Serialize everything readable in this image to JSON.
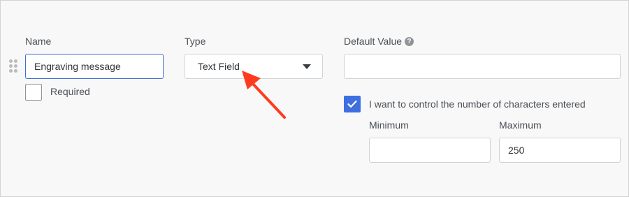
{
  "fields": {
    "name": {
      "label": "Name",
      "value": "Engraving message"
    },
    "required": {
      "label": "Required",
      "checked": false
    },
    "type": {
      "label": "Type",
      "selected": "Text Field"
    },
    "default_value": {
      "label": "Default Value",
      "value": "",
      "help_icon": "question-circle-icon"
    },
    "limit_characters": {
      "label": "I want to control the number of characters entered",
      "checked": true
    },
    "minimum": {
      "label": "Minimum",
      "value": ""
    },
    "maximum": {
      "label": "Maximum",
      "value": "250"
    }
  },
  "colors": {
    "accent": "#3d6fe0",
    "focus_border": "#3b6fd1",
    "annotation_arrow": "#ff3b1f"
  }
}
